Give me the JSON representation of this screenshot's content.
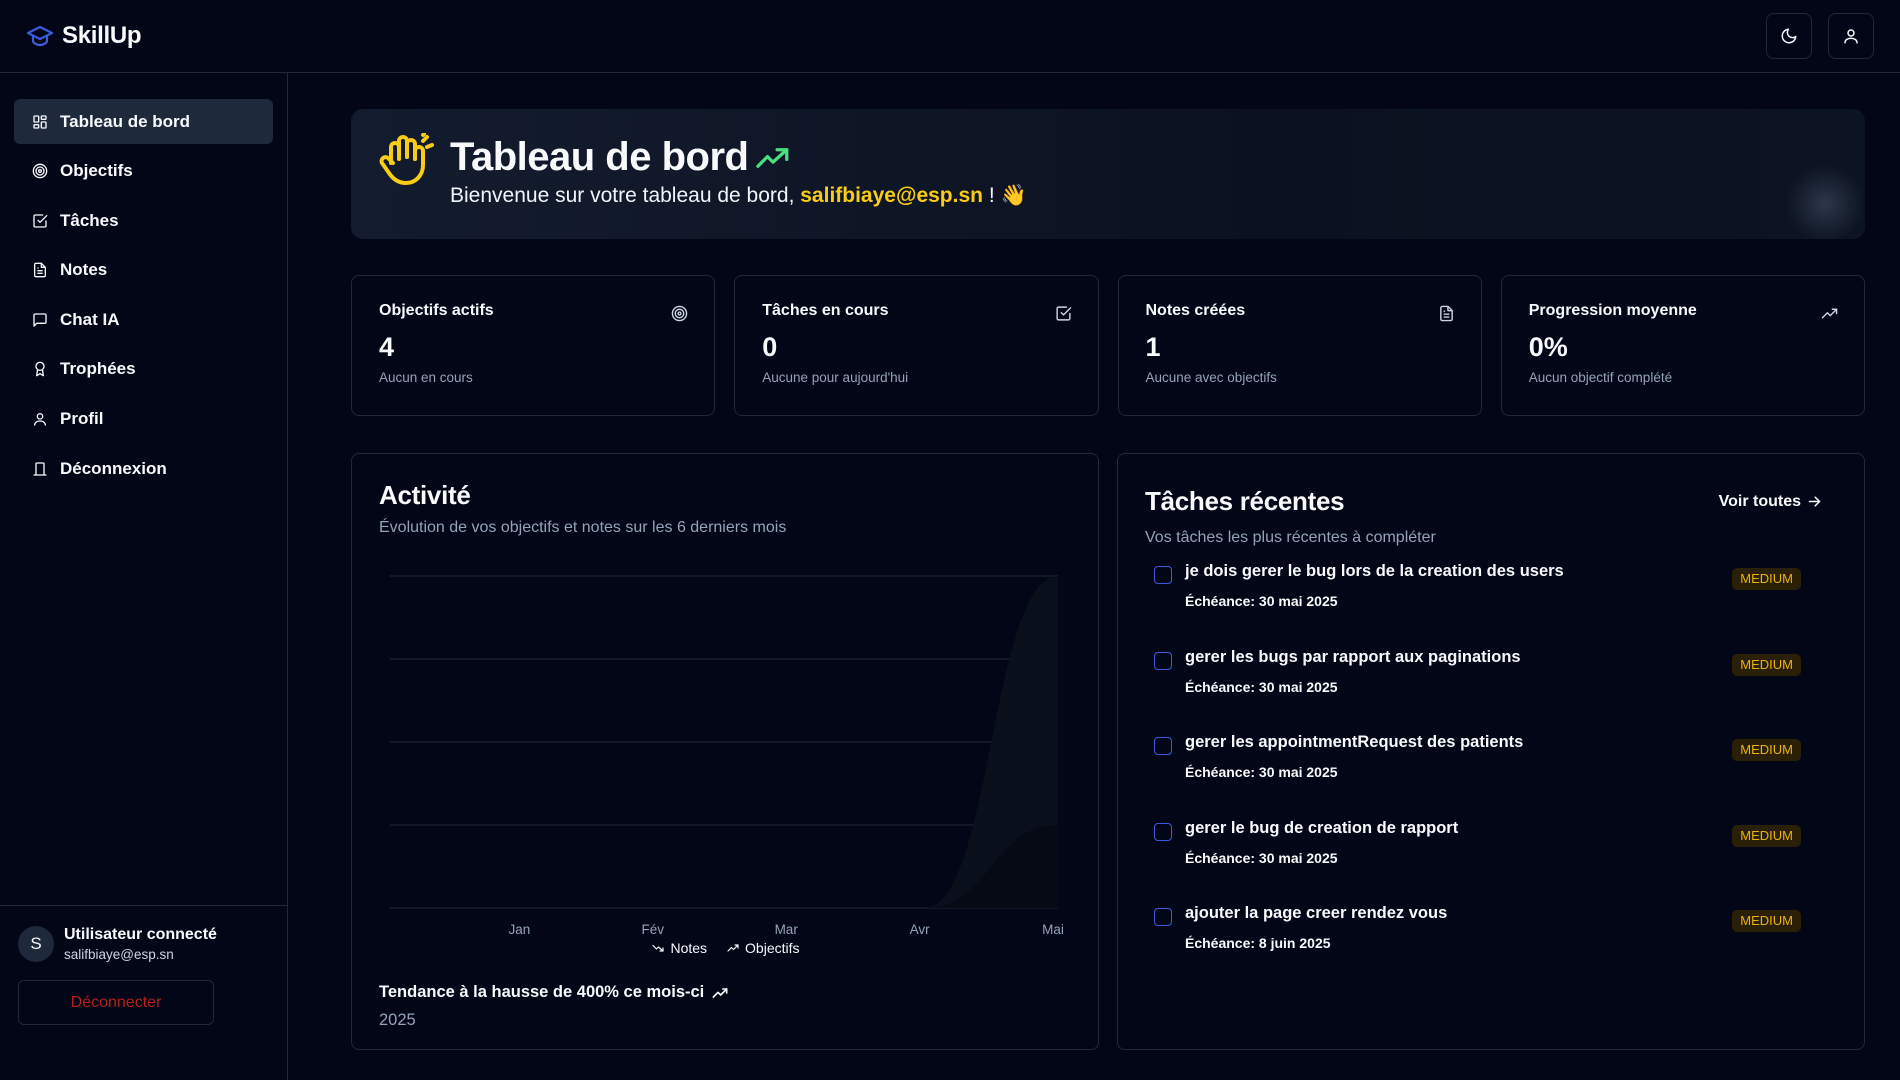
{
  "app": {
    "name": "SkillUp"
  },
  "sidebar": {
    "items": [
      {
        "label": "Tableau de bord",
        "icon": "dashboard-icon",
        "active": true
      },
      {
        "label": "Objectifs",
        "icon": "target-icon"
      },
      {
        "label": "Tâches",
        "icon": "check-square-icon"
      },
      {
        "label": "Notes",
        "icon": "file-text-icon"
      },
      {
        "label": "Chat IA",
        "icon": "message-icon"
      },
      {
        "label": "Trophées",
        "icon": "award-icon"
      },
      {
        "label": "Profil",
        "icon": "user-icon"
      },
      {
        "label": "Déconnexion",
        "icon": "logout-icon"
      }
    ],
    "user": {
      "initial": "S",
      "title": "Utilisateur connecté",
      "email": "salifbiaye@esp.sn"
    },
    "logout_label": "Déconnecter"
  },
  "hero": {
    "title": "Tableau de bord",
    "subtitle_prefix": "Bienvenue sur votre tableau de bord,",
    "email": "salifbiaye@esp.sn",
    "subtitle_suffix": "! 👋"
  },
  "stats": [
    {
      "title": "Objectifs actifs",
      "value": "4",
      "sub": "Aucun en cours",
      "icon": "target-icon"
    },
    {
      "title": "Tâches en cours",
      "value": "0",
      "sub": "Aucune pour aujourd'hui",
      "icon": "check-square-icon"
    },
    {
      "title": "Notes créées",
      "value": "1",
      "sub": "Aucune avec objectifs",
      "icon": "file-text-icon"
    },
    {
      "title": "Progression moyenne",
      "value": "0%",
      "sub": "Aucun objectif complété",
      "icon": "trending-up-icon"
    }
  ],
  "activity": {
    "title": "Activité",
    "description": "Évolution de vos objectifs et notes sur les 6 derniers mois",
    "legend": [
      "Notes",
      "Objectifs"
    ],
    "trend_text": "Tendance à la hausse de 400% ce mois-ci",
    "year": "2025"
  },
  "chart_data": {
    "type": "area",
    "categories": [
      "Jan",
      "Fév",
      "Mar",
      "Avr",
      "Mai"
    ],
    "series": [
      {
        "name": "Notes",
        "values": [
          0,
          0,
          0,
          0,
          1
        ]
      },
      {
        "name": "Objectifs",
        "values": [
          0,
          0,
          0,
          0,
          4
        ]
      }
    ],
    "ylim": [
      0,
      4
    ],
    "grid": true,
    "legend_position": "bottom"
  },
  "tasks": {
    "title": "Tâches récentes",
    "see_all": "Voir toutes",
    "description": "Vos tâches les plus récentes à compléter",
    "items": [
      {
        "title": "je dois gerer le bug lors de la creation des users",
        "due": "Échéance: 30 mai 2025",
        "priority": "MEDIUM"
      },
      {
        "title": "gerer les bugs par rapport aux paginations",
        "due": "Échéance: 30 mai 2025",
        "priority": "MEDIUM"
      },
      {
        "title": "gerer les appointmentRequest des patients",
        "due": "Échéance: 30 mai 2025",
        "priority": "MEDIUM"
      },
      {
        "title": "gerer le bug de creation de rapport",
        "due": "Échéance: 30 mai 2025",
        "priority": "MEDIUM"
      },
      {
        "title": "ajouter la page creer rendez vous",
        "due": "Échéance: 8 juin 2025",
        "priority": "MEDIUM"
      }
    ]
  },
  "colors": {
    "background": "#020617",
    "border": "#1e293b",
    "accent_yellow": "#facc15",
    "trend_green": "#4ade80",
    "brand_blue": "#3b5bdb",
    "danger": "#b91c1c"
  }
}
